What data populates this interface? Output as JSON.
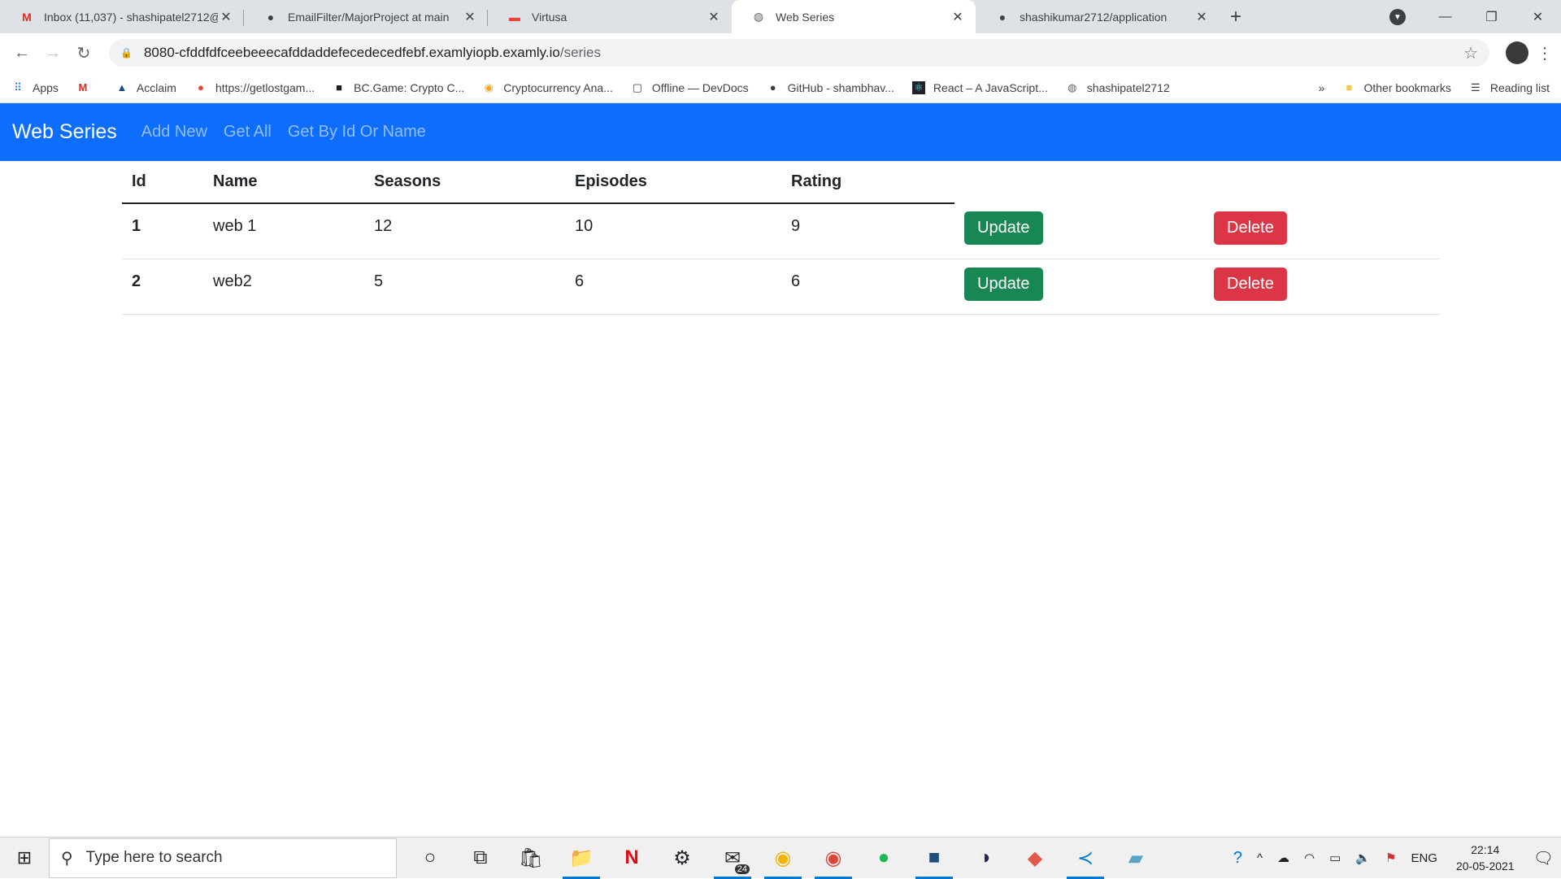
{
  "browser": {
    "tabs": [
      {
        "title": "Inbox (11,037) - shashipatel2712@",
        "icon": "gmail-icon",
        "active": false
      },
      {
        "title": "EmailFilter/MajorProject at main",
        "icon": "github-icon",
        "active": false
      },
      {
        "title": "Virtusa",
        "icon": "virtusa-icon",
        "active": false
      },
      {
        "title": "Web Series",
        "icon": "globe-icon",
        "active": true
      },
      {
        "title": "shashikumar2712/application",
        "icon": "github-icon",
        "active": false
      }
    ],
    "url_host": "8080-cfddfdfceebeeecafddaddefecedecedfebf.examlyiopb.examly.io",
    "url_path": "/series",
    "bookmarks": [
      "Apps",
      "",
      "Acclaim",
      "https://getlostgam...",
      "BC.Game: Crypto C...",
      "Cryptocurrency Ana...",
      "Offline — DevDocs",
      "GitHub - shambhav...",
      "React – A JavaScript...",
      "shashipatel2712"
    ],
    "more_bookmarks": "»",
    "other_bookmarks": "Other bookmarks",
    "reading_list": "Reading list"
  },
  "app": {
    "brand": "Web Series",
    "nav": [
      "Add New",
      "Get All",
      "Get By Id Or Name"
    ]
  },
  "table": {
    "headers": [
      "Id",
      "Name",
      "Seasons",
      "Episodes",
      "Rating"
    ],
    "rows": [
      {
        "id": "1",
        "name": "web 1",
        "seasons": "12",
        "episodes": "10",
        "rating": "9"
      },
      {
        "id": "2",
        "name": "web2",
        "seasons": "5",
        "episodes": "6",
        "rating": "6"
      }
    ],
    "update_label": "Update",
    "delete_label": "Delete"
  },
  "taskbar": {
    "search_placeholder": "Type here to search",
    "mail_badge": "24",
    "language": "ENG",
    "time": "22:14",
    "date": "20-05-2021"
  }
}
